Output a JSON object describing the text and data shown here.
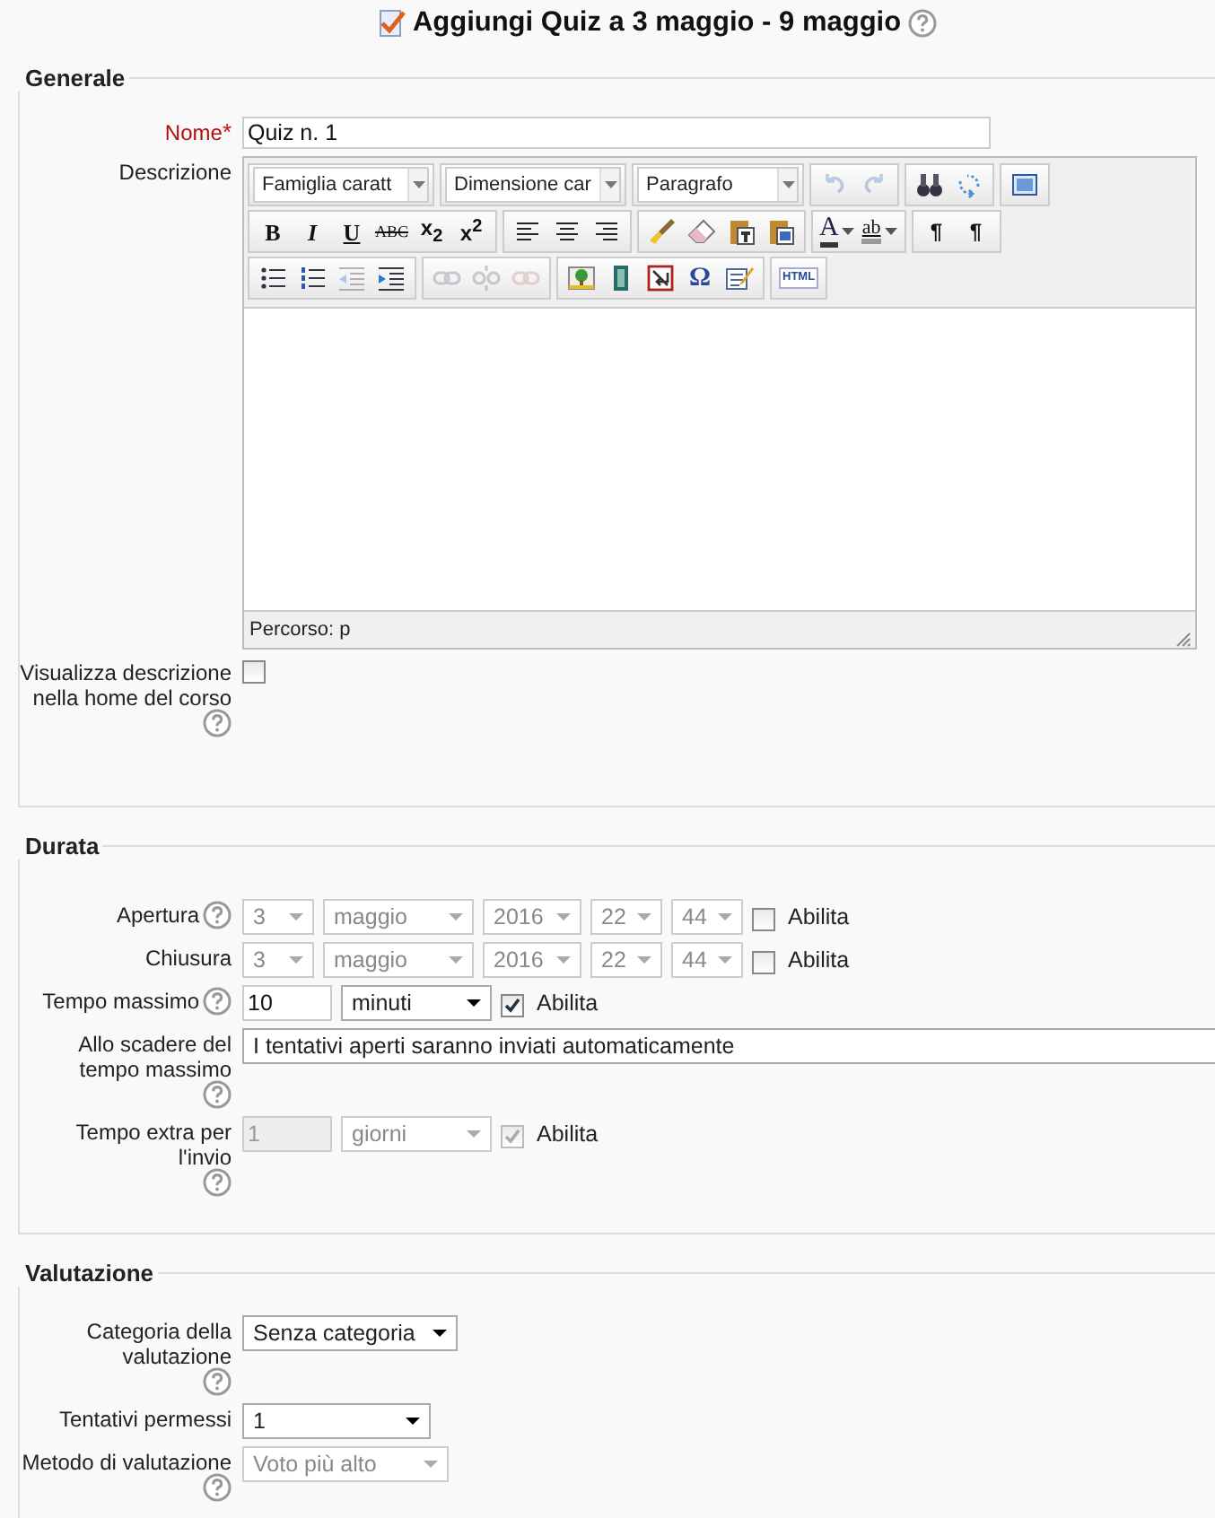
{
  "title": {
    "text": "Aggiungi Quiz a 3 maggio - 9 maggio",
    "help": true
  },
  "sections": [
    {
      "legend": "Generale",
      "rows": [
        {
          "kind": "text",
          "label": "Nome",
          "required_mark": "*",
          "help": false,
          "value": "Quiz n. 1"
        },
        {
          "kind": "editor",
          "label": "Descrizione",
          "help": false,
          "path": "Percorso: p",
          "toolbar": [
            [
              {
                "items": [
                  {
                    "kind": "select",
                    "value": "Famiglia caratt"
                  }
                ]
              },
              {
                "items": [
                  {
                    "kind": "select",
                    "value": "Dimensione car"
                  }
                ]
              },
              {
                "items": [
                  {
                    "kind": "select",
                    "value": "Paragrafo"
                  }
                ]
              },
              {
                "items": [
                  {
                    "kind": "undo",
                    "disabled": true
                  },
                  {
                    "kind": "redo",
                    "disabled": true
                  }
                ]
              },
              {
                "items": [
                  {
                    "kind": "find",
                    "disabled": false
                  },
                  {
                    "kind": "replace",
                    "disabled": false
                  }
                ]
              },
              {
                "items": [
                  {
                    "kind": "fullscreen",
                    "disabled": false
                  }
                ]
              }
            ],
            [
              {
                "items": [
                  {
                    "kind": "bold",
                    "label": "B",
                    "disabled": false
                  },
                  {
                    "kind": "italic",
                    "label": "I",
                    "disabled": false
                  },
                  {
                    "kind": "underline",
                    "label": "U",
                    "disabled": false
                  },
                  {
                    "kind": "strike",
                    "label": "ABC",
                    "disabled": false
                  },
                  {
                    "kind": "script",
                    "label": "x$_{2}$",
                    "disabled": false
                  },
                  {
                    "kind": "script",
                    "label": "x$^{2}$",
                    "disabled": false
                  }
                ]
              },
              {
                "items": [
                  {
                    "kind": "align-left",
                    "disabled": false
                  },
                  {
                    "kind": "align-center",
                    "disabled": false
                  },
                  {
                    "kind": "align-right",
                    "disabled": false
                  }
                ]
              },
              {
                "items": [
                  {
                    "kind": "brush",
                    "disabled": false
                  },
                  {
                    "kind": "eraser",
                    "disabled": false
                  },
                  {
                    "kind": "paste",
                    "disabled": false
                  },
                  {
                    "kind": "paste-word",
                    "disabled": false
                  }
                ]
              },
              {
                "items": [
                  {
                    "kind": "forecolor",
                    "label": "A",
                    "disabled": false
                  },
                  {
                    "kind": "backcolor",
                    "label": "ab",
                    "disabled": false
                  }
                ]
              },
              {
                "items": [
                  {
                    "kind": "ltr",
                    "label": "¶",
                    "disabled": false
                  },
                  {
                    "kind": "rtl",
                    "label": "¶",
                    "disabled": false
                  }
                ]
              }
            ],
            [
              {
                "items": [
                  {
                    "kind": "bullist",
                    "disabled": false
                  },
                  {
                    "kind": "numlist",
                    "disabled": false
                  },
                  {
                    "kind": "outdent",
                    "disabled": true
                  },
                  {
                    "kind": "indent",
                    "disabled": false
                  }
                ]
              },
              {
                "items": [
                  {
                    "kind": "link",
                    "disabled": true
                  },
                  {
                    "kind": "unlink",
                    "disabled": true
                  },
                  {
                    "kind": "anchor",
                    "disabled": true
                  }
                ]
              },
              {
                "items": [
                  {
                    "kind": "image",
                    "disabled": false
                  },
                  {
                    "kind": "media",
                    "disabled": false
                  },
                  {
                    "kind": "nonbreaking",
                    "disabled": false
                  },
                  {
                    "kind": "charmap",
                    "label": "Ω",
                    "disabled": false
                  },
                  {
                    "kind": "cleanup",
                    "disabled": false
                  }
                ]
              },
              {
                "items": [
                  {
                    "kind": "html",
                    "label": "HTML",
                    "disabled": false
                  }
                ]
              }
            ]
          ]
        },
        {
          "kind": "checkbox",
          "label": "Visualizza descrizione nella home del corso",
          "help": true,
          "checked": false
        }
      ]
    },
    {
      "legend": "Durata",
      "rows": [
        {
          "kind": "datetime",
          "label": "Apertura",
          "help": true,
          "disabled": true,
          "parts": [
            "3",
            "maggio",
            "2016",
            "22",
            "44"
          ],
          "enable": {
            "label": "Abilita",
            "checked": false
          }
        },
        {
          "kind": "datetime",
          "label": "Chiusura",
          "help": false,
          "disabled": true,
          "parts": [
            "3",
            "maggio",
            "2016",
            "22",
            "44"
          ],
          "enable": {
            "label": "Abilita",
            "checked": false
          }
        },
        {
          "kind": "duration",
          "label": "Tempo massimo",
          "help": true,
          "disabled": false,
          "value": "10",
          "unit": "minuti",
          "enable": {
            "label": "Abilita",
            "checked": true
          }
        },
        {
          "kind": "select-wide",
          "label": "Allo scadere del tempo massimo",
          "help": true,
          "disabled": false,
          "value": "I tentativi aperti saranno inviati automaticamente"
        },
        {
          "kind": "duration",
          "label": "Tempo extra per l'invio",
          "help": true,
          "disabled": true,
          "value": "1",
          "unit": "giorni",
          "enable": {
            "label": "Abilita",
            "checked": true
          }
        }
      ]
    },
    {
      "legend": "Valutazione",
      "rows": [
        {
          "kind": "select",
          "label": "Categoria della valutazione",
          "help": true,
          "disabled": false,
          "value": "Senza categoria"
        },
        {
          "kind": "select",
          "label": "Tentativi permessi",
          "help": false,
          "disabled": false,
          "value": "1"
        },
        {
          "kind": "select",
          "label": "Metodo di valutazione",
          "help": true,
          "disabled": true,
          "value": "Voto più alto"
        }
      ]
    }
  ]
}
